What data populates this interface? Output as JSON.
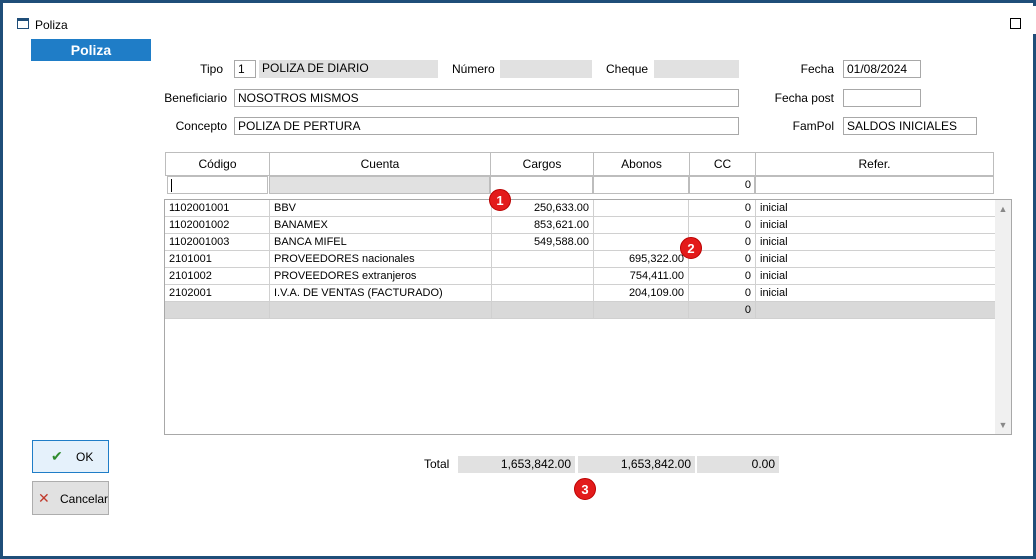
{
  "window": {
    "title": "Poliza"
  },
  "tab": {
    "label": "Poliza"
  },
  "form": {
    "tipo_label": "Tipo",
    "tipo_num": "1",
    "tipo_name": "POLIZA DE DIARIO",
    "numero_label": "Número",
    "numero_value": "",
    "cheque_label": "Cheque",
    "cheque_value": "",
    "fecha_label": "Fecha",
    "fecha_value": "01/08/2024",
    "beneficiario_label": "Beneficiario",
    "beneficiario_value": "NOSOTROS MISMOS",
    "fecha_post_label": "Fecha post",
    "fecha_post_value": "",
    "concepto_label": "Concepto",
    "concepto_value": "POLIZA DE PERTURA",
    "fampol_label": "FamPol",
    "fampol_value": "SALDOS INICIALES"
  },
  "grid": {
    "columns": [
      "Código",
      "Cuenta",
      "Cargos",
      "Abonos",
      "CC",
      "Refer."
    ],
    "filter": {
      "cc": "0"
    },
    "rows": [
      [
        "1102001001",
        "BBV",
        "250,633.00",
        "",
        "0",
        "inicial"
      ],
      [
        "1102001002",
        "BANAMEX",
        "853,621.00",
        "",
        "0",
        "inicial"
      ],
      [
        "1102001003",
        "BANCA MIFEL",
        "549,588.00",
        "",
        "0",
        "inicial"
      ],
      [
        "2101001",
        "PROVEEDORES nacionales",
        "",
        "695,322.00",
        "0",
        "inicial"
      ],
      [
        "2101002",
        "PROVEEDORES extranjeros",
        "",
        "754,411.00",
        "0",
        "inicial"
      ],
      [
        "2102001",
        "I.V.A. DE VENTAS (FACTURADO)",
        "",
        "204,109.00",
        "0",
        "inicial"
      ]
    ],
    "blank_row_cc": "0",
    "scroll_up_icon": "chevron-up-icon",
    "scroll_down_icon": "chevron-down-icon"
  },
  "buttons": {
    "ok_label": "OK",
    "ok_icon": "check-icon",
    "cancel_label": "Cancelar",
    "cancel_icon": "x-icon"
  },
  "totals": {
    "label": "Total",
    "cargos": "1,653,842.00",
    "abonos": "1,653,842.00",
    "diferencia": "0.00"
  },
  "annotations": [
    "1",
    "2",
    "3"
  ],
  "colors": {
    "accent": "#1f7dc7",
    "frame": "#1f4e79",
    "badge": "#e31b1b",
    "ok_check": "#2e8b2e",
    "cancel_x": "#c0392b"
  }
}
